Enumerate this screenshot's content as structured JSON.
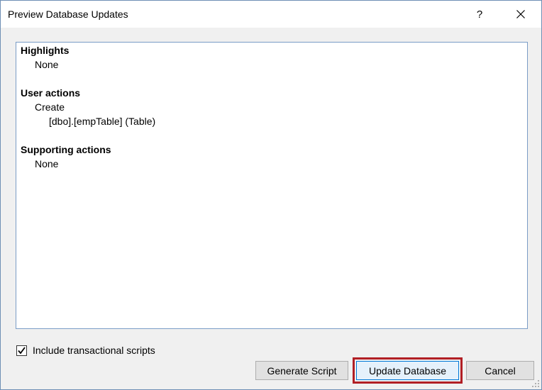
{
  "dialog": {
    "title": "Preview Database Updates",
    "help_label": "?",
    "close_icon": "close-icon"
  },
  "preview": {
    "sections": [
      {
        "title": "Highlights",
        "items": [
          {
            "text": "None",
            "level": 1
          }
        ]
      },
      {
        "title": "User actions",
        "items": [
          {
            "text": "Create",
            "level": 1
          },
          {
            "text": "[dbo].[empTable] (Table)",
            "level": 2
          }
        ]
      },
      {
        "title": "Supporting actions",
        "items": [
          {
            "text": "None",
            "level": 1
          }
        ]
      }
    ]
  },
  "options": {
    "include_transactional_label": "Include transactional scripts",
    "include_transactional_checked": true
  },
  "buttons": {
    "generate_script": "Generate Script",
    "update_database": "Update Database",
    "cancel": "Cancel"
  },
  "colors": {
    "highlight_border": "#b11f24",
    "focus_border": "#0078d7",
    "panel_border": "#7a9cc6"
  }
}
